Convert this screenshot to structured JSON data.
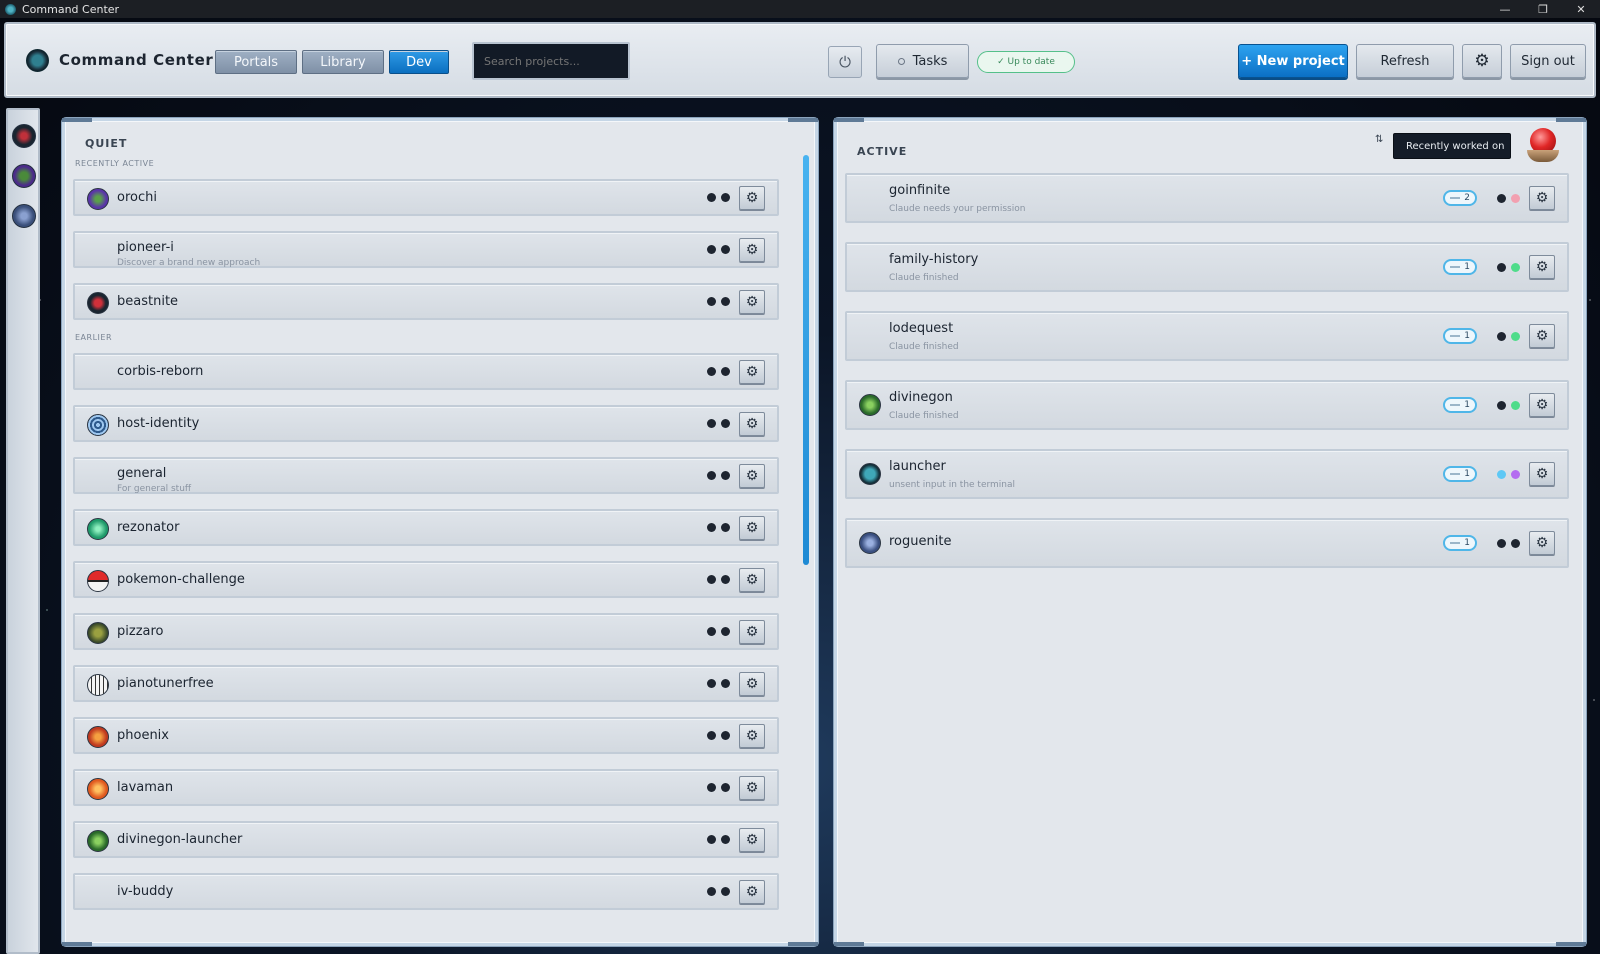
{
  "window": {
    "title": "Command Center"
  },
  "header": {
    "brand": "Command Center",
    "segments": [
      "Portals",
      "Library",
      "Dev"
    ],
    "active_segment": "Dev",
    "search_placeholder": "Search projects...",
    "tasks_label": "Tasks",
    "status_label": "✓ Up to date",
    "new_project_label": "+ New project",
    "refresh_label": "Refresh",
    "sign_out_label": "Sign out"
  },
  "quiet": {
    "heading": "QUIET",
    "recent_label": "RECENTLY ACTIVE",
    "earlier_label": "EARLIER",
    "recent": [
      {
        "name": "orochi",
        "desc": "",
        "icon": "orochi-icon"
      },
      {
        "name": "pioneer-i",
        "desc": "Discover a brand new approach",
        "icon": ""
      },
      {
        "name": "beastnite",
        "desc": "",
        "icon": "beastnite-icon"
      }
    ],
    "earlier": [
      {
        "name": "corbis-reborn",
        "desc": "",
        "icon": ""
      },
      {
        "name": "host-identity",
        "desc": "",
        "icon": "fingerprint-icon"
      },
      {
        "name": "general",
        "desc": "For general stuff",
        "icon": ""
      },
      {
        "name": "rezonator",
        "desc": "",
        "icon": "rezonator-icon"
      },
      {
        "name": "pokemon-challenge",
        "desc": "",
        "icon": "pokeball-icon"
      },
      {
        "name": "pizzaro",
        "desc": "",
        "icon": "pizzaro-icon"
      },
      {
        "name": "pianotunerfree",
        "desc": "",
        "icon": "piano-icon"
      },
      {
        "name": "phoenix",
        "desc": "",
        "icon": "phoenix-icon"
      },
      {
        "name": "lavaman",
        "desc": "",
        "icon": "lavaman-icon"
      },
      {
        "name": "divinegon-launcher",
        "desc": "",
        "icon": "divinegon-icon"
      },
      {
        "name": "iv-buddy",
        "desc": "",
        "icon": ""
      }
    ]
  },
  "active": {
    "heading": "ACTIVE",
    "sort_label": "Recently worked on",
    "items": [
      {
        "name": "goinfinite",
        "desc": "Claude needs your permission",
        "count": "2",
        "dot1": "#1e2530",
        "dot2": "#f2a0b0",
        "icon": ""
      },
      {
        "name": "family-history",
        "desc": "Claude finished",
        "count": "1",
        "dot1": "#1e2530",
        "dot2": "#4fdc8a",
        "icon": ""
      },
      {
        "name": "lodequest",
        "desc": "Claude finished",
        "count": "1",
        "dot1": "#1e2530",
        "dot2": "#4fdc8a",
        "icon": ""
      },
      {
        "name": "divinegon",
        "desc": "Claude finished",
        "count": "1",
        "dot1": "#1e2530",
        "dot2": "#4fdc8a",
        "icon": "divinegon-icon"
      },
      {
        "name": "launcher",
        "desc": "unsent input in the terminal",
        "count": "1",
        "dot1": "#5ec8f5",
        "dot2": "#b46cf0",
        "icon": "launcher-icon"
      },
      {
        "name": "roguenite",
        "desc": "",
        "count": "1",
        "dot1": "#1e2530",
        "dot2": "#1e2530",
        "icon": "roguenite-icon"
      }
    ]
  }
}
